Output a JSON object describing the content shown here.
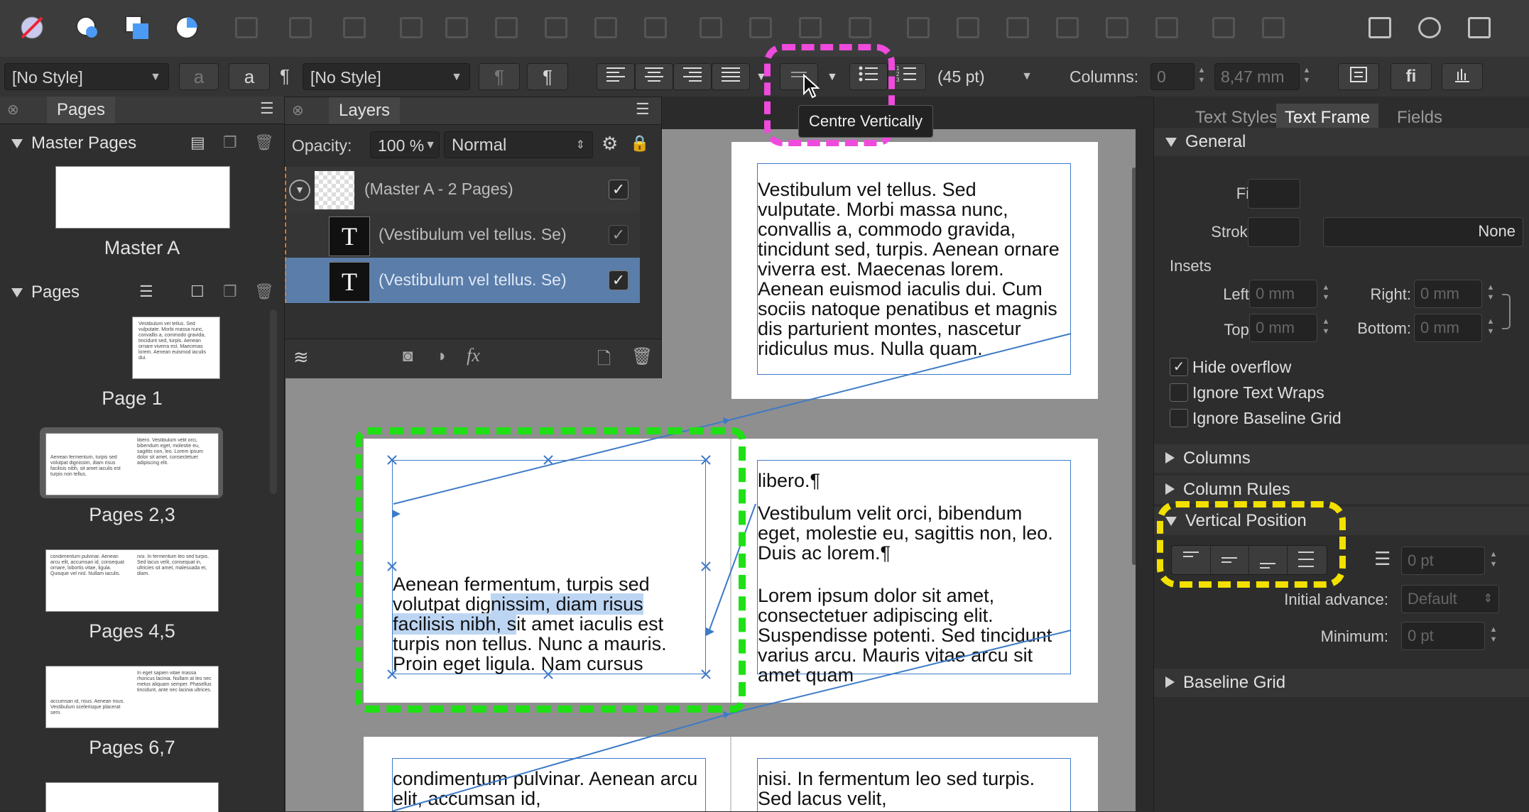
{
  "toolbar_text": {
    "char_style": "[No Style]",
    "para_style": "[No Style]",
    "leading": "(45 pt)",
    "columns_label": "Columns:",
    "columns_value": "0",
    "gutter_value": "8,47 mm",
    "tooltip": "Centre Vertically"
  },
  "pages_panel": {
    "tab": "Pages",
    "master_section": "Master Pages",
    "master_label": "Master A",
    "pages_section": "Pages",
    "thumbs": [
      {
        "label": "Page 1"
      },
      {
        "label": "Pages 2,3"
      },
      {
        "label": "Pages 4,5"
      },
      {
        "label": "Pages 6,7"
      }
    ]
  },
  "layers_panel": {
    "tab": "Layers",
    "opacity_label": "Opacity:",
    "opacity_value": "100 %",
    "blend_mode": "Normal",
    "rows": [
      {
        "name": "(Master A - 2 Pages)"
      },
      {
        "name": "(Vestibulum vel tellus. Se)"
      },
      {
        "name": "(Vestibulum vel tellus. Se)"
      }
    ]
  },
  "canvas": {
    "page1_text": "Vestibulum vel tellus. Sed vulputate. Morbi massa nunc, convallis a, commodo gravida, tincidunt sed, turpis. Aenean ornare viverra est. Maecenas lorem. Aenean euismod iaculis dui. Cum sociis natoque penatibus et magnis dis parturient montes, nascetur ridiculus mus. Nulla quam.",
    "page2_pre": "Aenean fermentum, turpis sed volutpat dig",
    "page2_sel": "nissim, diam risus facilisis nibh, s",
    "page2_post": "it amet iaculis est turpis non tellus. Nunc a mauris. Proin eget ligula. Nam cursus",
    "page3_p1": "libero.¶",
    "page3_p2": "Vestibulum velit orci, bibendum eget, molestie eu, sagittis non, leo. Duis ac lorem.¶",
    "page3_p3": "Lorem ipsum dolor sit amet, consectetuer adipiscing elit. Suspendisse potenti. Sed tincidunt varius arcu. Mauris vitae arcu sit amet quam",
    "page4_text": "condimentum pulvinar. Aenean arcu elit, accumsan id,",
    "page5_text": "nisi. In fermentum leo sed turpis. Sed lacus velit,"
  },
  "right_panel": {
    "tabs": [
      "Text Styles",
      "Text Frame",
      "Fields"
    ],
    "general": "General",
    "fill_label": "Fill:",
    "stroke_label": "Stroke:",
    "stroke_value": "None",
    "insets": "Insets",
    "left_label": "Left:",
    "left_value": "0 mm",
    "right_label": "Right:",
    "right_value": "0 mm",
    "top_label": "Top:",
    "top_value": "0 mm",
    "bottom_label": "Bottom:",
    "bottom_value": "0 mm",
    "hide_overflow": "Hide overflow",
    "ignore_wraps": "Ignore Text Wraps",
    "ignore_baseline": "Ignore Baseline Grid",
    "columns": "Columns",
    "column_rules": "Column Rules",
    "vertical_position": "Vertical Position",
    "vp_value": "0 pt",
    "initial_advance_label": "Initial advance:",
    "initial_advance_value": "Default",
    "minimum_label": "Minimum:",
    "minimum_value": "0 pt",
    "baseline_grid": "Baseline Grid"
  },
  "colors": {
    "highlight_magenta": "#ee4bdc",
    "highlight_green": "#1ee014",
    "highlight_yellow": "#f2e000",
    "frame_blue": "#3d7ac7",
    "selected_row": "#5a7daa"
  }
}
